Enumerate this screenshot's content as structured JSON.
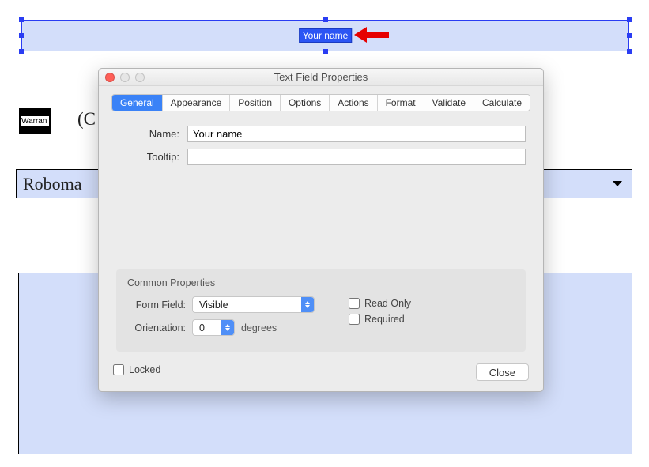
{
  "background": {
    "selected_field_label": "Your name",
    "warran_text": "Warran",
    "paren_c": "(C",
    "dropdown_text": "Roboma"
  },
  "dialog": {
    "title": "Text Field Properties",
    "tabs": {
      "general": "General",
      "appearance": "Appearance",
      "position": "Position",
      "options": "Options",
      "actions": "Actions",
      "format": "Format",
      "validate": "Validate",
      "calculate": "Calculate"
    },
    "general": {
      "name_label": "Name:",
      "name_value": "Your name",
      "tooltip_label": "Tooltip:",
      "tooltip_value": ""
    },
    "common": {
      "heading": "Common Properties",
      "form_field_label": "Form Field:",
      "form_field_value": "Visible",
      "orientation_label": "Orientation:",
      "orientation_value": "0",
      "degrees_label": "degrees",
      "read_only_label": "Read Only",
      "required_label": "Required"
    },
    "footer": {
      "locked_label": "Locked",
      "close_label": "Close"
    }
  }
}
